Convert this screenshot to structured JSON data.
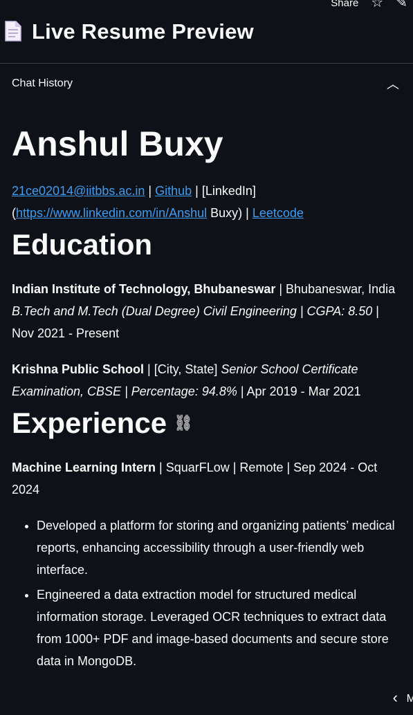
{
  "toolbar": {
    "share_label": "Share",
    "star_icon": "star-icon",
    "edit_icon": "pencil-icon"
  },
  "header": {
    "title": "Live Resume Preview",
    "icon": "document-icon"
  },
  "expander": {
    "label": "Chat History",
    "icon": "chevron-up-icon"
  },
  "resume": {
    "name": "Anshul Buxy",
    "contact": {
      "email": "21ce02014@iitbbs.ac.in",
      "sep1": " | ",
      "github": "Github",
      "sep2": " | [LinkedIn]",
      "paren_open": "(",
      "linkedin_url": "https://www.linkedin.com/in/Anshul",
      "linkedin_tail": " Buxy) | ",
      "leetcode": "Leetcode"
    },
    "education": {
      "heading": "Education",
      "entries": [
        {
          "school": "Indian Institute of Technology, Bhubaneswar",
          "location": " | Bhubaneswar, India",
          "degree": "B.Tech and M.Tech (Dual Degree) Civil Engineering | CGPA: 8.50",
          "dates": " | Nov 2021 - Present"
        },
        {
          "school": "Krishna Public School",
          "location": " | [City, State] ",
          "degree": "Senior School Certificate Examination, CBSE | Percentage: 94.8%",
          "dates": " | Apr 2019 - Mar 2021"
        }
      ]
    },
    "experience": {
      "heading": "Experience",
      "role": "Machine Learning Intern",
      "details": " | SquarFLow | Remote | Sep 2024 - Oct 2024",
      "bullets": [
        "Developed a platform for storing and organizing patients’ medical reports, enhancing accessibility through a user-friendly web interface.",
        "Engineered a data extraction model for structured medical information storage. Leveraged OCR techniques to extract data from 1000+ PDF and image-based documents and secure store data in MongoDB."
      ]
    }
  },
  "nav": {
    "prev_icon": "chevron-left-icon",
    "partial_label": "M"
  }
}
